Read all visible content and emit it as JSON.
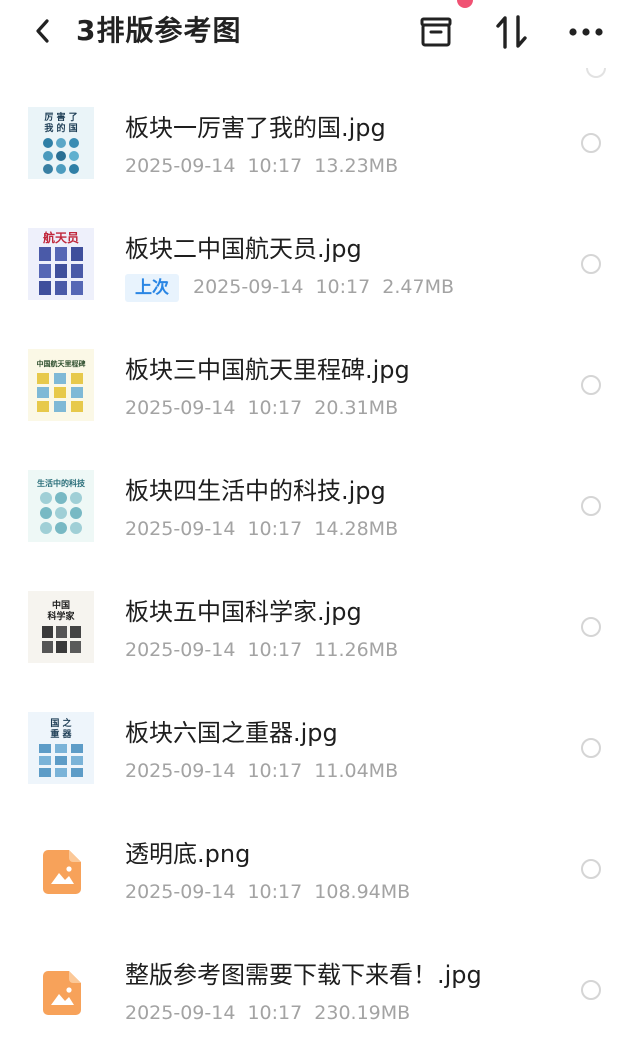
{
  "header": {
    "title": "3排版参考图",
    "back_icon": "chevron-left-icon",
    "archive_icon": "archive-box-icon",
    "sort_icon": "sort-arrows-icon",
    "more_icon": "more-dots-icon",
    "notification_dot_color": "#f05273"
  },
  "files": [
    {
      "name": "板块一厉害了我的国.jpg",
      "date": "2025-09-14",
      "time": "10:17",
      "size": "13.23MB",
      "tag": "",
      "thumb_text": "厉 害 了\n我 的 国",
      "thumb_style": "circles-blue"
    },
    {
      "name": "板块二中国航天员.jpg",
      "date": "2025-09-14",
      "time": "10:17",
      "size": "2.47MB",
      "tag": "上次",
      "thumb_text": "航天员",
      "thumb_style": "portraits-purple"
    },
    {
      "name": "板块三中国航天里程碑.jpg",
      "date": "2025-09-14",
      "time": "10:17",
      "size": "20.31MB",
      "tag": "",
      "thumb_text": "中国航天里程碑",
      "thumb_style": "cards-yellow"
    },
    {
      "name": "板块四生活中的科技.jpg",
      "date": "2025-09-14",
      "time": "10:17",
      "size": "14.28MB",
      "tag": "",
      "thumb_text": "生活中的科技",
      "thumb_style": "circles-teal"
    },
    {
      "name": "板块五中国科学家.jpg",
      "date": "2025-09-14",
      "time": "10:17",
      "size": "11.26MB",
      "tag": "",
      "thumb_text": "中国\n科学家",
      "thumb_style": "portraits-dark"
    },
    {
      "name": "板块六国之重器.jpg",
      "date": "2025-09-14",
      "time": "10:17",
      "size": "11.04MB",
      "tag": "",
      "thumb_text": "国 之\n重 器",
      "thumb_style": "cards-blue"
    },
    {
      "name": "透明底.png",
      "date": "2025-09-14",
      "time": "10:17",
      "size": "108.94MB",
      "tag": "",
      "thumb_text": "",
      "thumb_style": "image-file-icon"
    },
    {
      "name": "整版参考图需要下载下来看！.jpg",
      "date": "2025-09-14",
      "time": "10:17",
      "size": "230.19MB",
      "tag": "",
      "thumb_text": "",
      "thumb_style": "image-file-icon"
    }
  ],
  "colors": {
    "meta_text": "#a3a3a3",
    "tag_bg": "#e8f3fd",
    "tag_text": "#2a86e4",
    "image_icon": "#f7a25a"
  }
}
